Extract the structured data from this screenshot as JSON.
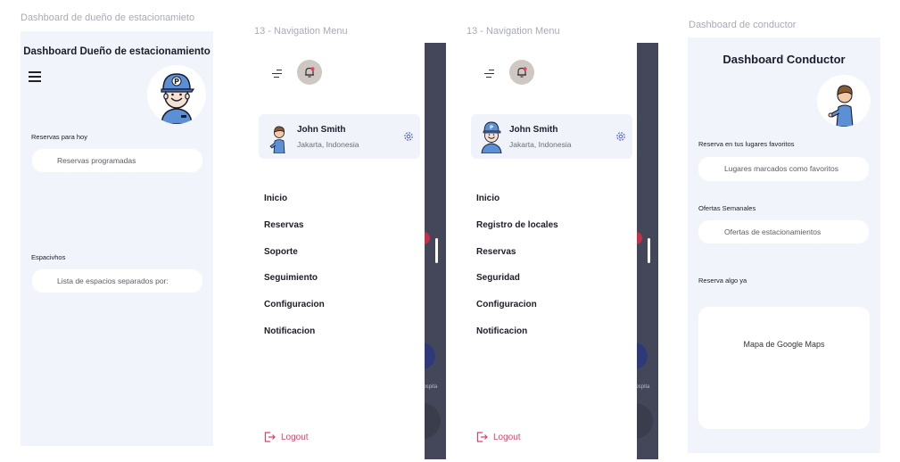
{
  "frames": {
    "owner": {
      "label": "Dashboard de dueño de estacionamieto",
      "title": "Dashboard Dueño de estacionamiento",
      "section_today": "Reservas para hoy",
      "scheduled_button": "Reservas programadas",
      "section_spaces": "Espacivhos",
      "spaces_button": "Lista de espacios separados por:"
    },
    "nav1": {
      "label": "13 - Navigation Menu",
      "user_name": "John Smith",
      "user_location": "Jakarta, Indonesia",
      "menu": [
        "Inicio",
        "Reservas",
        "Soporte",
        "Seguimiento",
        "Configuracion",
        "Notificacion"
      ],
      "logout": "Logout",
      "behind_text": "Hospita"
    },
    "nav2": {
      "label": "13 - Navigation Menu",
      "user_name": "John Smith",
      "user_location": "Jakarta, Indonesia",
      "menu": [
        "Inicio",
        "Registro de locales",
        "Reservas",
        "Seguridad",
        "Configuracion",
        "Notificacion"
      ],
      "logout": "Logout",
      "behind_text": "Hospita"
    },
    "driver": {
      "label": "Dashboard de conductor",
      "title": "Dashboard Conductor",
      "section_favorites": "Reserva en tus lugares favoritos",
      "favorites_button": "Lugares marcados como favoritos",
      "section_offers": "Ofertas Semanales",
      "offers_button": "Ofertas de estacionamientos",
      "section_book": "Reserva algo ya",
      "map_label": "Mapa de Google Maps"
    }
  },
  "icons": {
    "menu": "hamburger-icon",
    "bell": "bell-icon",
    "gear": "gear-icon",
    "logout": "logout-icon"
  },
  "colors": {
    "frame_bg": "#f1f4fa",
    "logout": "#e23f6b",
    "overlay": "#3c3f4e",
    "bell_bg": "#cfc7c1"
  }
}
